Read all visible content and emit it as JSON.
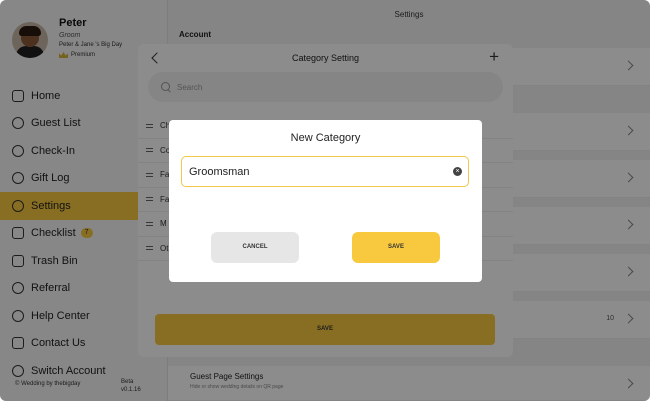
{
  "colors": {
    "accent": "#f8c93e",
    "overlay": "rgba(0,0,0,0.45)"
  },
  "profile": {
    "name": "Peter",
    "role": "Groom",
    "event": "Peter & Jane 's Big Day",
    "tier": "Premium"
  },
  "sidebar": {
    "items": [
      {
        "label": "Home",
        "icon": "home-icon"
      },
      {
        "label": "Guest List",
        "icon": "guests-icon"
      },
      {
        "label": "Check-In",
        "icon": "check-in-icon"
      },
      {
        "label": "Gift Log",
        "icon": "heart-icon"
      },
      {
        "label": "Settings",
        "icon": "gear-icon",
        "active": true
      },
      {
        "label": "Checklist",
        "icon": "checklist-icon",
        "badge": "7"
      },
      {
        "label": "Trash Bin",
        "icon": "trash-icon"
      },
      {
        "label": "Referral",
        "icon": "share-icon"
      },
      {
        "label": "Help Center",
        "icon": "help-icon"
      },
      {
        "label": "Contact Us",
        "icon": "mail-icon"
      },
      {
        "label": "Switch Account",
        "icon": "switch-icon"
      }
    ],
    "copyright": "© Wedding by thebigday",
    "version_label": "Beta",
    "version": "v0.1.16"
  },
  "settings": {
    "title": "Settings",
    "section_account": "Account",
    "count_value": "10",
    "guest_page": {
      "title": "Guest Page Settings",
      "subtitle": "Hide or show wedding details on QR page"
    }
  },
  "category_panel": {
    "title": "Category Setting",
    "search_placeholder": "Search",
    "items": [
      "Ch",
      "Co",
      "Fa",
      "Fa",
      "M",
      "Ot"
    ],
    "save_label": "SAVE"
  },
  "dialog": {
    "title": "New Category",
    "input_value": "Groomsman",
    "cancel_label": "CANCEL",
    "save_label": "SAVE"
  }
}
